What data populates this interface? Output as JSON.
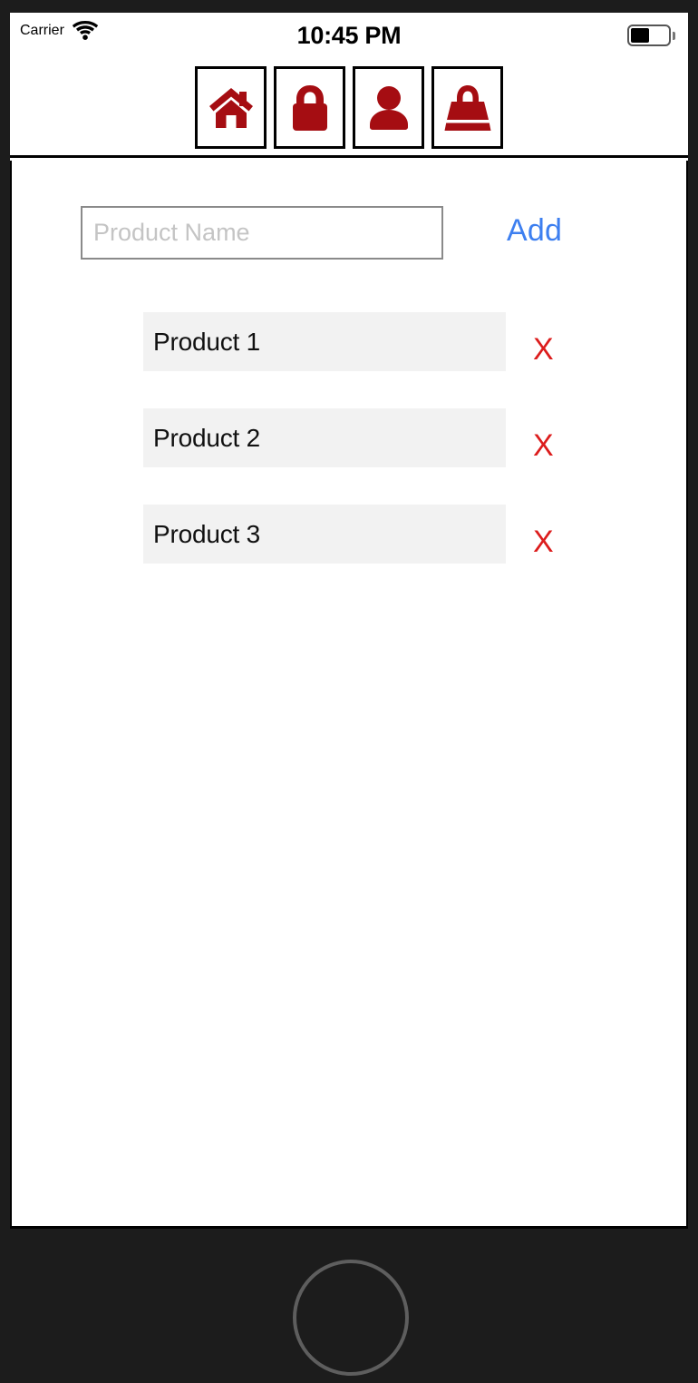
{
  "status_bar": {
    "carrier": "Carrier",
    "wifi_icon": "wifi-icon",
    "time": "10:45 PM",
    "battery_icon": "battery-icon"
  },
  "nav_bar": {
    "buttons": [
      {
        "icon": "home-icon",
        "label": "Home"
      },
      {
        "icon": "lock-icon",
        "label": "Lock"
      },
      {
        "icon": "person-icon",
        "label": "Account"
      },
      {
        "icon": "shopping-bag-icon",
        "label": "Cart"
      }
    ]
  },
  "main": {
    "input": {
      "placeholder": "Product Name",
      "value": ""
    },
    "add_label": "Add",
    "products": [
      {
        "name": "Product 1",
        "delete_label": "X"
      },
      {
        "name": "Product 2",
        "delete_label": "X"
      },
      {
        "name": "Product 3",
        "delete_label": "X"
      }
    ]
  },
  "device": {
    "home_button": "home-button"
  },
  "colors": {
    "icon_red": "#A50D12",
    "delete_red": "#DC1C1C",
    "accent_blue": "#3D7FF0",
    "row_bg": "#F2F2F2",
    "bezel": "#1C1C1C"
  }
}
